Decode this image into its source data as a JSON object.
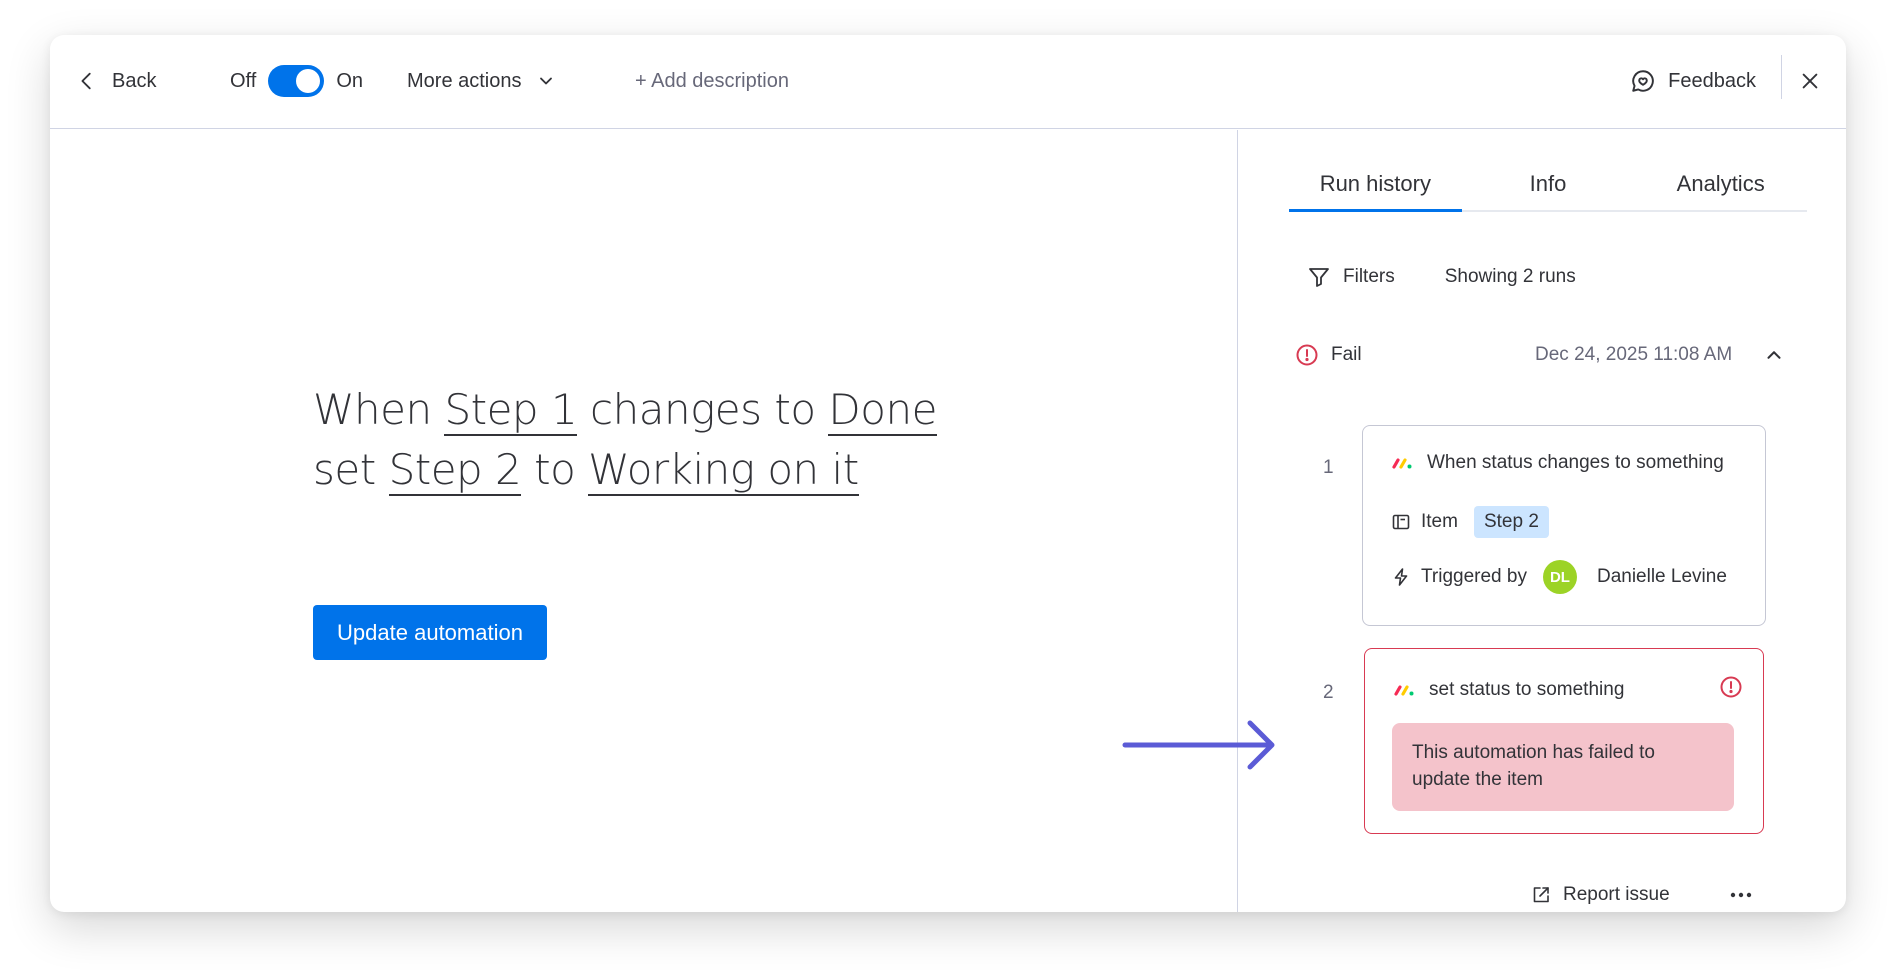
{
  "topbar": {
    "back_label": "Back",
    "toggle_off_label": "Off",
    "toggle_on_label": "On",
    "toggle_state": "on",
    "more_actions_label": "More actions",
    "add_description_label": "+ Add description",
    "feedback_label": "Feedback"
  },
  "recipe": {
    "part1": "When",
    "trigger_column": "Step 1",
    "part2": "changes to",
    "trigger_value": "Done",
    "part3": "set",
    "action_column": "Step 2",
    "part4": "to",
    "action_value": "Working on it",
    "update_button_label": "Update automation"
  },
  "panel": {
    "tabs": [
      {
        "label": "Run history",
        "active": true
      },
      {
        "label": "Info",
        "active": false
      },
      {
        "label": "Analytics",
        "active": false
      }
    ],
    "filters_label": "Filters",
    "showing_label": "Showing 2 runs",
    "run": {
      "status": "Fail",
      "date": "Dec 24, 2025 11:08 AM",
      "steps": [
        {
          "number": "1",
          "title": "When status changes to something",
          "item_label": "Item",
          "item_value": "Step 2",
          "triggered_by_label": "Triggered by",
          "user_initials": "DL",
          "user_name": "Danielle Levine"
        },
        {
          "number": "2",
          "title": "set status to something",
          "error_message": "This automation has failed to update the item"
        }
      ]
    },
    "report_issue_label": "Report issue"
  },
  "colors": {
    "primary": "#0073ea",
    "error": "#d83a52",
    "error_bg": "#f4c3cb",
    "chip_bg": "#cce5ff",
    "avatar_bg": "#9cd326",
    "annotation_arrow": "#5b5bd6"
  }
}
